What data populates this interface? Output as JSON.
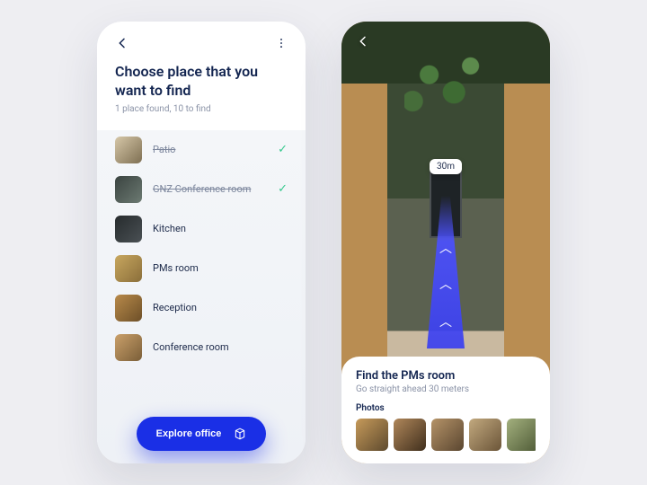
{
  "left": {
    "title_line1": "Choose place that you",
    "title_line2": "want to find",
    "subtitle": "1 place found, 10 to find",
    "items": [
      {
        "label": "Patio",
        "done": true
      },
      {
        "label": "GNZ Conference room",
        "done": true
      },
      {
        "label": "Kitchen",
        "done": false
      },
      {
        "label": "PMs room",
        "done": false
      },
      {
        "label": "Reception",
        "done": false
      },
      {
        "label": "Conference room",
        "done": false
      }
    ],
    "cta": "Explore office"
  },
  "right": {
    "distance_badge": "30m",
    "card_title": "Find the PMs room",
    "card_sub": "Go straight ahead 30 meters",
    "photos_label": "Photos",
    "photo_count": 5
  }
}
